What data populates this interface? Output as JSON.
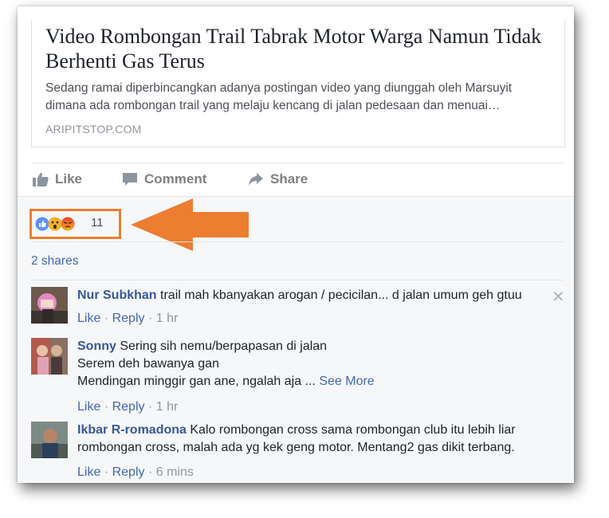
{
  "post": {
    "title": "Video Rombongan Trail Tabrak Motor Warga Namun Tidak Berhenti Gas Terus",
    "description": "Sedang ramai diperbincangkan adanya postingan video yang diunggah oleh Marsuyit dimana ada rombongan trail yang melaju kencang di jalan pedesaan dan menuai…",
    "domain": "ARIPITSTOP.COM"
  },
  "actions": {
    "like": "Like",
    "comment": "Comment",
    "share": "Share"
  },
  "reactions": {
    "icons": [
      "like-icon",
      "wow-icon",
      "angry-icon"
    ],
    "count": "11",
    "highlight_color": "#ed7d31"
  },
  "shares": "2 shares",
  "comments": [
    {
      "name": "Nur Subkhan",
      "text": "trail mah kbanyakan arogan / pecicilan... d jalan umum geh gtuu",
      "like": "Like",
      "reply": "Reply",
      "sep": "·",
      "time": "1 hr"
    },
    {
      "name": "Sonny",
      "line1": "Sering sih nemu/berpapasan di jalan",
      "line2": "Serem deh bawanya gan",
      "line3": "Mendingan minggir gan ane, ngalah aja ...",
      "see_more": "See More",
      "like": "Like",
      "reply": "Reply",
      "sep": "·",
      "time": "1 hr"
    },
    {
      "name": "Ikbar R-romadona",
      "text": "Kalo rombongan cross sama rombongan club itu lebih liar rombongan cross, malah ada yg kek geng motor. Mentang2 gas dikit terbang.",
      "like": "Like",
      "reply": "Reply",
      "sep": "·",
      "time": "6 mins"
    }
  ],
  "colors": {
    "link": "#4267b2",
    "name": "#365899",
    "arrow": "#ed7d31"
  }
}
